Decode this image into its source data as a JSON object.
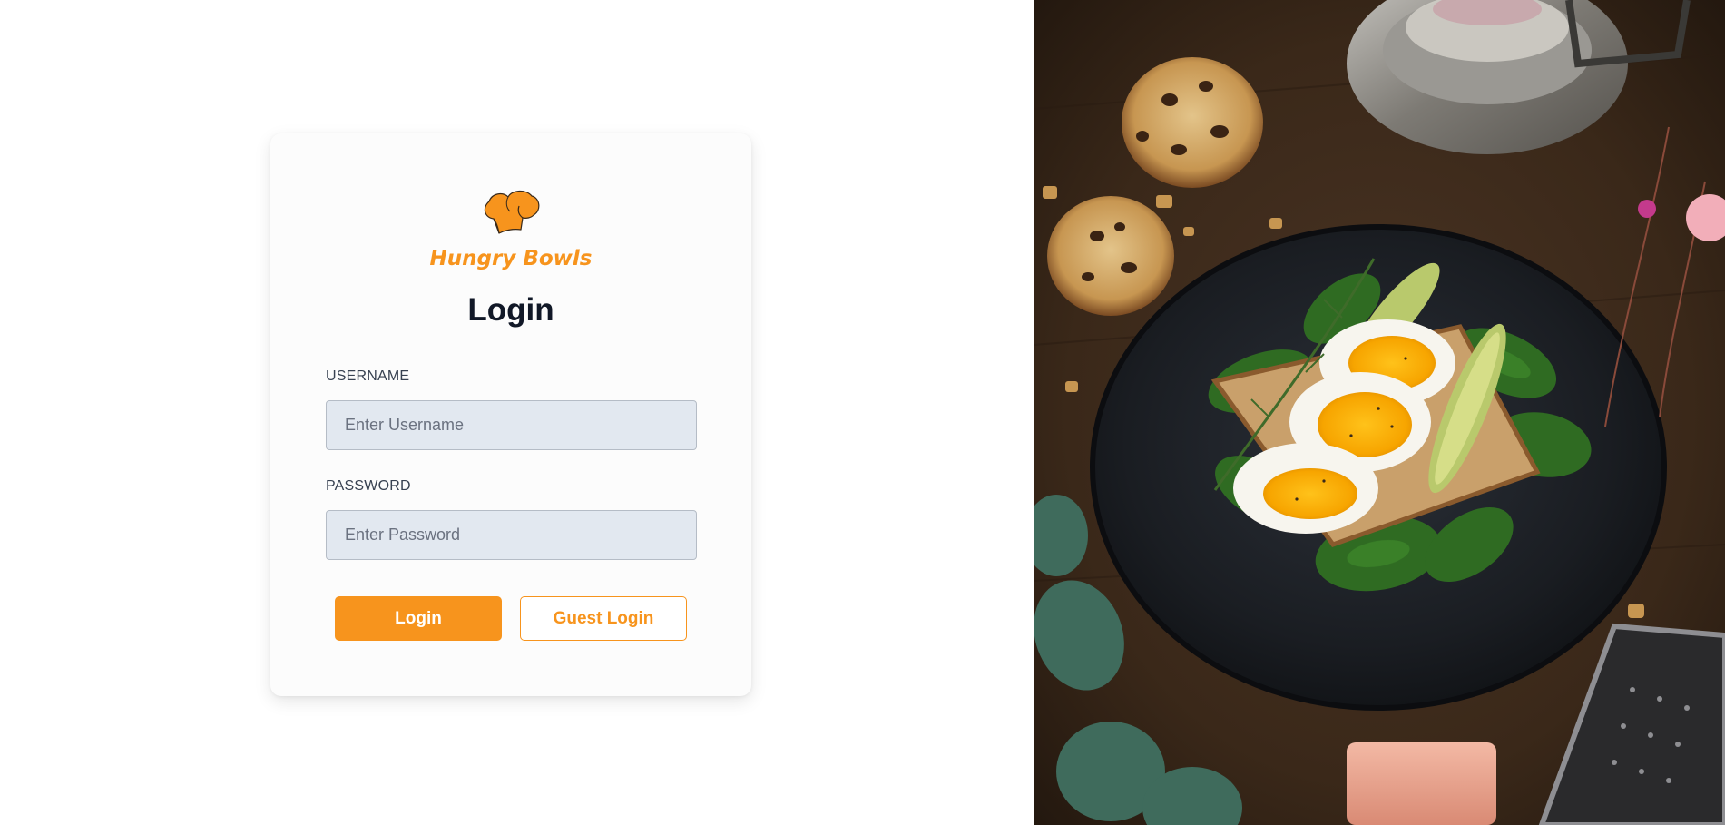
{
  "brand": {
    "name": "Hungry Bowls",
    "logo_icon": "chef-hat-icon",
    "accent_color": "#f7941d"
  },
  "login_card": {
    "title": "Login",
    "username": {
      "label": "USERNAME",
      "placeholder": "Enter Username",
      "value": ""
    },
    "password": {
      "label": "PASSWORD",
      "placeholder": "Enter Password",
      "value": ""
    },
    "buttons": {
      "login_label": "Login",
      "guest_label": "Guest Login"
    }
  },
  "hero_image": {
    "subject": "food-photo-egg-avocado-toast-on-dark-plate"
  }
}
